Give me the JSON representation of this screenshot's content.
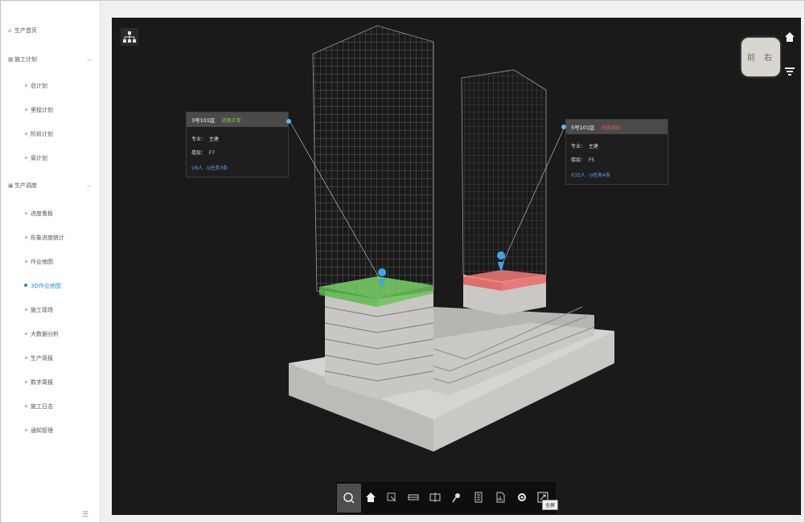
{
  "sidebar": {
    "items": [
      {
        "label": "生产首页",
        "icon": "home-icon",
        "type": "group"
      },
      {
        "label": "施工计划",
        "icon": "calendar-icon",
        "type": "group",
        "expanded": true
      },
      {
        "label": "总计划",
        "type": "sub"
      },
      {
        "label": "里程计划",
        "type": "sub"
      },
      {
        "label": "阶段计划",
        "type": "sub"
      },
      {
        "label": "周计划",
        "type": "sub"
      },
      {
        "label": "生产调度",
        "icon": "dispatch-icon",
        "type": "group",
        "expanded": true
      },
      {
        "label": "进度看板",
        "type": "sub"
      },
      {
        "label": "形象进度统计",
        "type": "sub"
      },
      {
        "label": "作业地图",
        "type": "sub"
      },
      {
        "label": "3D作业地图",
        "type": "sub",
        "active": true
      },
      {
        "label": "施工现场",
        "type": "sub"
      },
      {
        "label": "大数据分析",
        "type": "sub"
      },
      {
        "label": "生产简报",
        "type": "sub"
      },
      {
        "label": "数字周报",
        "type": "sub"
      },
      {
        "label": "施工日志",
        "type": "sub"
      },
      {
        "label": "通知管理",
        "type": "sub"
      }
    ],
    "collapse_icon": "collapse-icon"
  },
  "viewport": {
    "viewcube": {
      "left": "前",
      "right": "右"
    },
    "cards": [
      {
        "zone": "3号101区",
        "status": "进度正常",
        "status_color": "#8bc34a",
        "major_label": "专业：",
        "major_value": "主建",
        "floor_label": "楼层：",
        "floor_value": "F7",
        "workers": "8人",
        "tasks": "任务3条"
      },
      {
        "zone": "5号101区",
        "status": "进度滞后",
        "status_color": "#e85a4f",
        "major_label": "专业：",
        "major_value": "主建",
        "floor_label": "楼层：",
        "floor_value": "F5",
        "workers": "35人",
        "tasks": "任务4条"
      }
    ],
    "highlight_colors": {
      "normal": "#7bd36a",
      "delayed": "#f07a7a"
    }
  },
  "toolbar": {
    "tools": [
      "search-icon",
      "home-icon",
      "measure-icon",
      "section-icon",
      "split-icon",
      "pin-icon",
      "document-icon",
      "report-icon",
      "settings-icon",
      "fullscreen-icon"
    ],
    "tooltip": "全屏"
  }
}
